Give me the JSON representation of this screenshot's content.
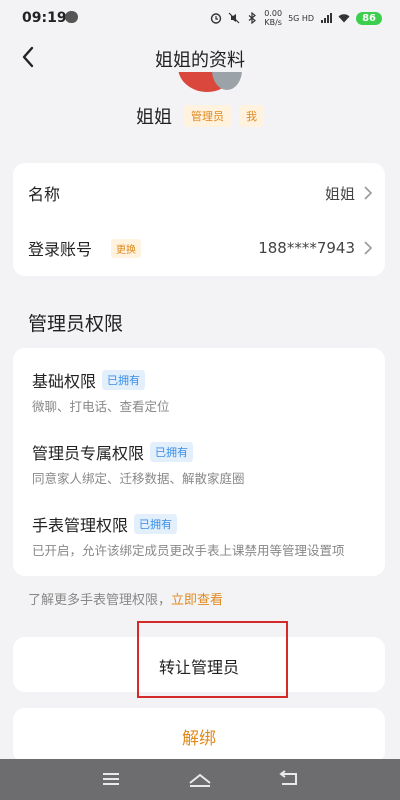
{
  "status_bar": {
    "time": "09:19",
    "net_speed_top": "0.00",
    "net_speed_bottom": "KB/s",
    "signal": "5G HD",
    "battery": "86"
  },
  "header": {
    "title": "姐姐的资料"
  },
  "profile": {
    "name": "姐姐",
    "tag_admin": "管理员",
    "tag_me": "我"
  },
  "info": {
    "name_label": "名称",
    "name_value": "姐姐",
    "account_label": "登录账号",
    "account_edit": "更换",
    "account_value": "188****7943"
  },
  "permissions": {
    "section_title": "管理员权限",
    "items": [
      {
        "title": "基础权限",
        "badge": "已拥有",
        "desc": "微聊、打电话、查看定位"
      },
      {
        "title": "管理员专属权限",
        "badge": "已拥有",
        "desc": "同意家人绑定、迁移数据、解散家庭圈"
      },
      {
        "title": "手表管理权限",
        "badge": "已拥有",
        "desc": "已开启，允许该绑定成员更改手表上课禁用等管理设置项"
      }
    ]
  },
  "more": {
    "text": "了解更多手表管理权限，",
    "link": "立即查看"
  },
  "actions": {
    "transfer": "转让管理员",
    "unbind": "解绑"
  },
  "colors": {
    "accent": "#e08a1e",
    "badge_blue": "#3a8ee6",
    "highlight": "#d52a2a"
  }
}
